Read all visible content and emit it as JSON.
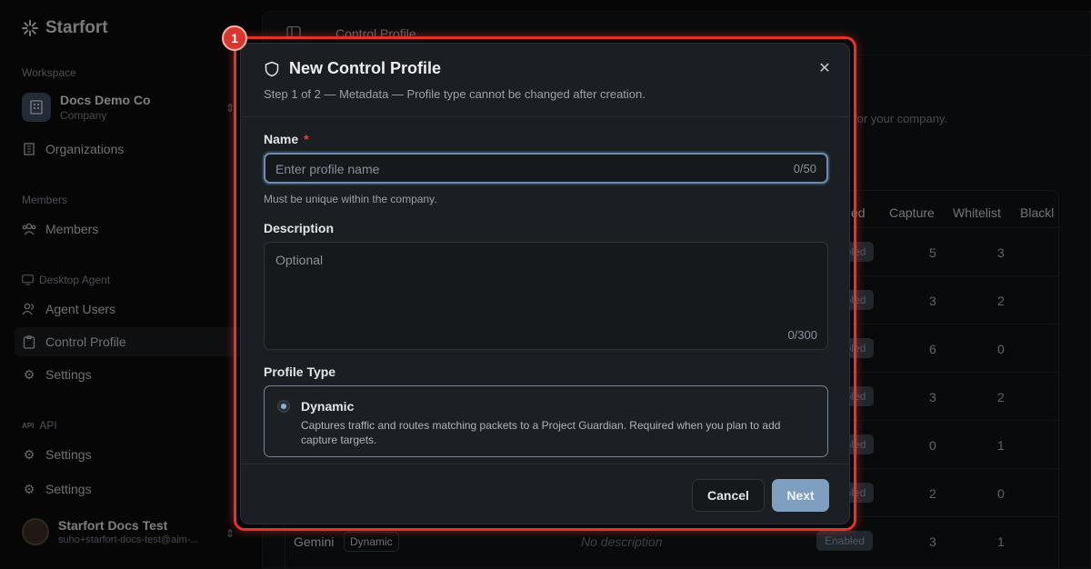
{
  "sidebar": {
    "brand": "Starfort",
    "workspace_label": "Workspace",
    "workspace_name": "Docs Demo Co",
    "workspace_sub": "Company",
    "organizations": "Organizations",
    "members_label": "Members",
    "members": "Members",
    "desktop_agent_label": "Desktop Agent",
    "agent_users": "Agent Users",
    "control_profile": "Control Profile",
    "settings_1": "Settings",
    "api_label": "API",
    "settings_2": "Settings",
    "settings_3": "Settings",
    "user_name": "Starfort Docs Test",
    "user_email": "suho+starfort-docs-test@aim-..."
  },
  "main": {
    "breadcrumb": "Control Profile",
    "description_fragment": "for your company.",
    "columns": [
      "ed",
      "Capture",
      "Whitelist",
      "Blackl"
    ],
    "rows": [
      {
        "status": "abled",
        "capture": "5",
        "whitelist": "3"
      },
      {
        "status": "abled",
        "capture": "3",
        "whitelist": "2"
      },
      {
        "status": "abled",
        "capture": "6",
        "whitelist": "0"
      },
      {
        "status": "abled",
        "capture": "3",
        "whitelist": "2"
      },
      {
        "status": "abled",
        "capture": "0",
        "whitelist": "1"
      },
      {
        "status": "abled",
        "capture": "2",
        "whitelist": "0"
      },
      {
        "name": "Gemini",
        "type": "Dynamic",
        "description": "No description",
        "status": "Enabled",
        "capture": "3",
        "whitelist": "1"
      }
    ]
  },
  "annotation": {
    "badge": "1",
    "color": "#e0352c"
  },
  "dialog": {
    "title": "New Control Profile",
    "subtitle": "Step 1 of 2 — Metadata — Profile type cannot be changed after creation.",
    "name_label": "Name",
    "required_mark": "*",
    "name_placeholder": "Enter profile name",
    "name_counter": "0/50",
    "name_hint": "Must be unique within the company.",
    "description_label": "Description",
    "description_placeholder": "Optional",
    "description_counter": "0/300",
    "profile_type_label": "Profile Type",
    "profile_type_option": "Dynamic",
    "profile_type_desc": "Captures traffic and routes matching packets to a Project Guardian. Required when you plan to add capture targets.",
    "cancel": "Cancel",
    "next": "Next",
    "close_icon": "close-icon"
  }
}
